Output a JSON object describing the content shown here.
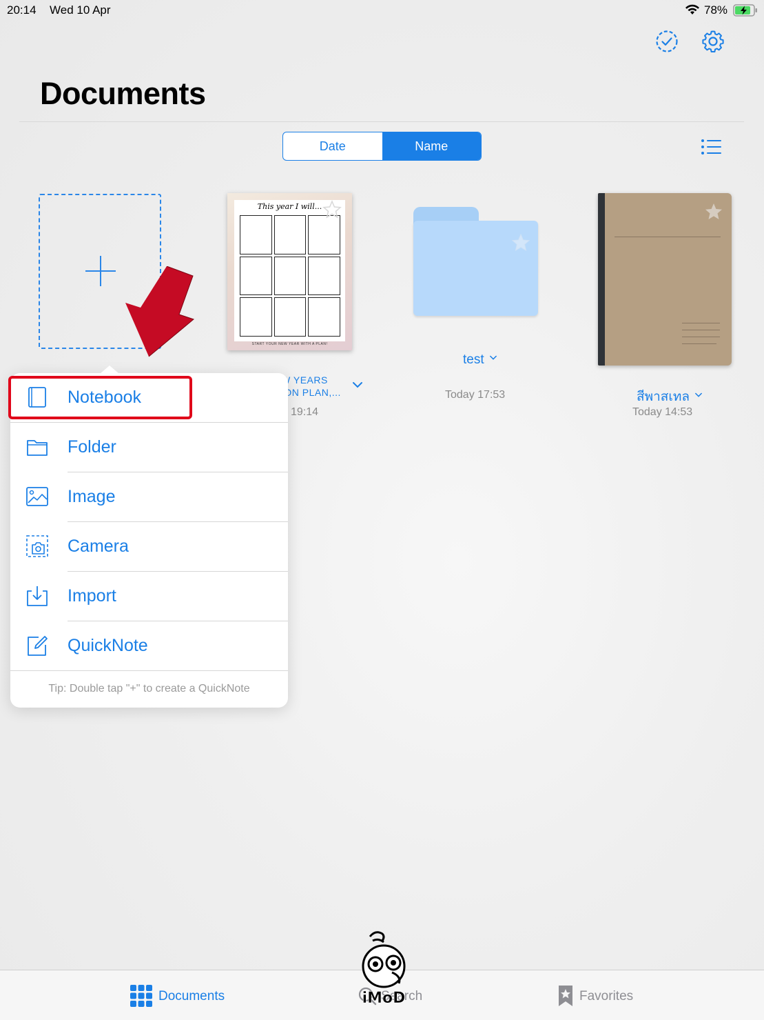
{
  "status_bar": {
    "time": "20:14",
    "date": "Wed 10 Apr",
    "battery_percent": "78%",
    "battery_level": 0.78
  },
  "header": {
    "title": "Documents",
    "select_icon": "checkmark-circle-dashed-icon",
    "settings_icon": "gear-icon"
  },
  "sort": {
    "options": [
      "Date",
      "Name"
    ],
    "selected": "Name",
    "list_view_icon": "list-icon"
  },
  "documents": [
    {
      "kind": "planner",
      "thumbnail_heading": "This year I will...",
      "thumbnail_footer": "START YOUR NEW YEAR WITH A PLAN!",
      "name_line1": "W YEARS",
      "name_line2": "ION PLAN,...",
      "date": "19:14"
    },
    {
      "kind": "folder",
      "name": "test",
      "date": "Today 17:53"
    },
    {
      "kind": "notebook",
      "name": "สีพาสเทล",
      "date": "Today 14:53"
    }
  ],
  "popover": {
    "items": [
      {
        "label": "Notebook",
        "icon": "notebook-icon"
      },
      {
        "label": "Folder",
        "icon": "folder-icon"
      },
      {
        "label": "Image",
        "icon": "image-icon"
      },
      {
        "label": "Camera",
        "icon": "camera-icon"
      },
      {
        "label": "Import",
        "icon": "import-icon"
      },
      {
        "label": "QuickNote",
        "icon": "compose-icon"
      }
    ],
    "tip": "Tip: Double tap \"+\" to create a QuickNote"
  },
  "tab_bar": {
    "tabs": [
      {
        "label": "Documents",
        "icon": "grid-icon",
        "selected": true
      },
      {
        "label": "Search",
        "icon": "search-icon",
        "selected": false
      },
      {
        "label": "Favorites",
        "icon": "bookmark-star-icon",
        "selected": false
      }
    ]
  },
  "watermark": {
    "text": "iMoD"
  },
  "colors": {
    "accent": "#1a7fe6",
    "highlight": "#e0061a",
    "arrow": "#c50b24",
    "folder": "#b7d9fb",
    "notebook_cover": "#b59f83"
  }
}
